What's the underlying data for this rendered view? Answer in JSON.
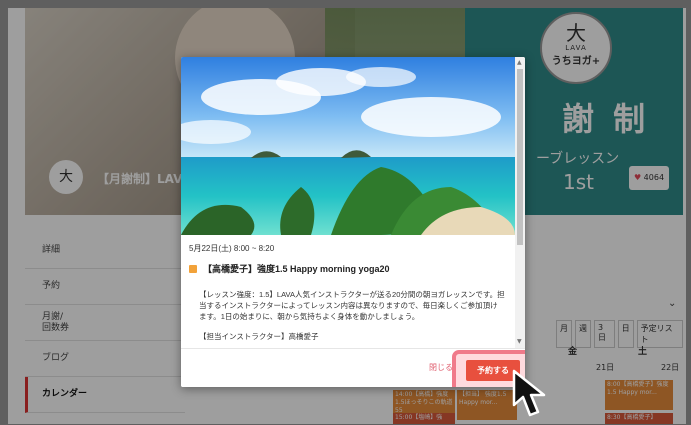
{
  "hero": {
    "lesson_title": "【月謝制】LAVA",
    "logo_brand": "LAVA",
    "logo_name": "うちヨガ+",
    "logo_mark": "大",
    "big_title": "謝 制",
    "sub_title": "ーブレッスン",
    "first": "1st",
    "favorites": "4064"
  },
  "sidebar": {
    "items": [
      {
        "label": "詳細"
      },
      {
        "label": "予約"
      },
      {
        "label": "月謝/\n回数券"
      },
      {
        "label": "ブログ"
      },
      {
        "label": "カレンダー"
      }
    ]
  },
  "calendar": {
    "views": [
      "月",
      "週",
      "3日",
      "日",
      "予定リスト"
    ],
    "days": [
      {
        "label": "金",
        "date": "21日"
      },
      {
        "label": "土",
        "date": "22日"
      }
    ],
    "events": [
      "14:00【高橋】強度1.5ほっそりこの軌道55",
      "【担当】 強度1.5 Happy mor...",
      "8:00【高橋愛子】強度1.5 Happy mor...",
      "15:00【塩崎】強",
      "8:30【高橋愛子】"
    ]
  },
  "modal": {
    "date": "5月22日(土) 8:00 ~ 8:20",
    "lesson_name": "【高橋愛子】強度1.5 Happy morning yoga20",
    "description": "【レッスン強度：1.5】LAVA人気インストラクターが送る20分間の朝ヨガレッスンです。担当するインストラクターによってレッスン内容は異なりますので、毎日楽しくご参加頂けます。1日の始まりに、朝から気持ちよく身体を動かしましょう。",
    "instructor_heading": "【担当インストラクター】高橋愛子",
    "close_label": "閉じる",
    "reserve_label": "予約する"
  },
  "colors": {
    "reserve_button": "#e8503e",
    "highlight": "#f07a8a",
    "lesson_dot": "#f2a23a",
    "hero_teal": "#2f8c8a"
  },
  "icons": {
    "cursor": "arrow-cursor-icon",
    "heart": "heart-icon",
    "scroll_up": "triangle-up-icon",
    "scroll_down": "triangle-down-icon"
  }
}
